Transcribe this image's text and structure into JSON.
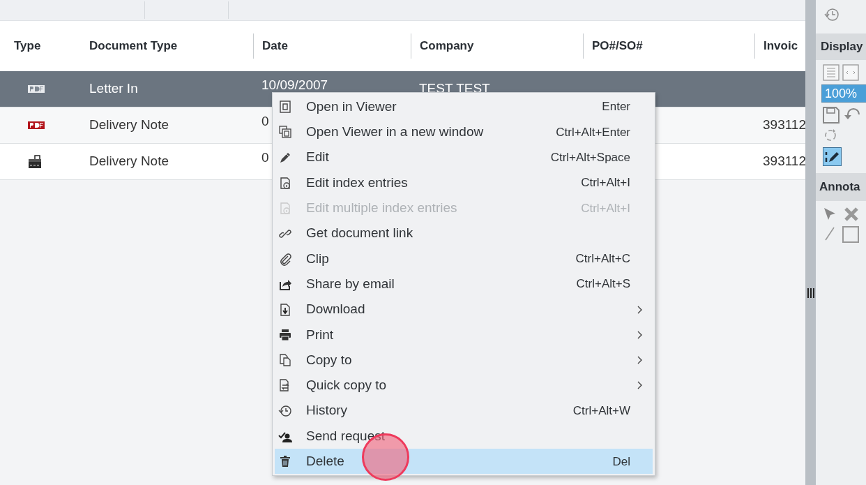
{
  "table": {
    "columns": [
      "Type",
      "Document Type",
      "Date",
      "Company",
      "PO#/SO#",
      "Invoic"
    ],
    "rows": [
      {
        "kind": "pdf",
        "document_type": "Letter In",
        "date": "10/09/2007",
        "company": "TEST TEST",
        "selected": true
      },
      {
        "kind": "pdf",
        "document_type": "Delivery Note",
        "date": "0",
        "invoice": "393112",
        "selected": false
      },
      {
        "kind": "scan",
        "document_type": "Delivery Note",
        "date": "0",
        "invoice": "393112",
        "selected": false
      }
    ]
  },
  "context_menu": {
    "items": [
      {
        "label": "Open in Viewer",
        "shortcut": "Enter",
        "submenu": false,
        "disabled": false,
        "selected": false
      },
      {
        "label": "Open Viewer in a new window",
        "shortcut": "Ctrl+Alt+Enter",
        "submenu": false,
        "disabled": false,
        "selected": false
      },
      {
        "label": "Edit",
        "shortcut": "Ctrl+Alt+Space",
        "submenu": false,
        "disabled": false,
        "selected": false
      },
      {
        "label": "Edit index entries",
        "shortcut": "Ctrl+Alt+I",
        "submenu": false,
        "disabled": false,
        "selected": false
      },
      {
        "label": "Edit multiple index entries",
        "shortcut": "Ctrl+Alt+I",
        "submenu": false,
        "disabled": true,
        "selected": false
      },
      {
        "label": "Get document link",
        "submenu": false,
        "disabled": false,
        "selected": false
      },
      {
        "label": "Clip",
        "shortcut": "Ctrl+Alt+C",
        "submenu": false,
        "disabled": false,
        "selected": false
      },
      {
        "label": "Share by email",
        "shortcut": "Ctrl+Alt+S",
        "submenu": false,
        "disabled": false,
        "selected": false
      },
      {
        "label": "Download",
        "submenu": true,
        "disabled": false,
        "selected": false
      },
      {
        "label": "Print",
        "submenu": true,
        "disabled": false,
        "selected": false
      },
      {
        "label": "Copy to",
        "submenu": true,
        "disabled": false,
        "selected": false
      },
      {
        "label": "Quick copy to",
        "submenu": true,
        "disabled": false,
        "selected": false
      },
      {
        "label": "History",
        "shortcut": "Ctrl+Alt+W",
        "submenu": false,
        "disabled": false,
        "selected": false
      },
      {
        "label": "Send request",
        "submenu": false,
        "disabled": false,
        "selected": false
      },
      {
        "label": "Delete",
        "shortcut": "Del",
        "submenu": false,
        "disabled": false,
        "selected": true
      }
    ]
  },
  "side_panel": {
    "display_header": "Display",
    "zoom_value": "100%",
    "annotations_header": "Annota",
    "edit_mode_on": true
  }
}
